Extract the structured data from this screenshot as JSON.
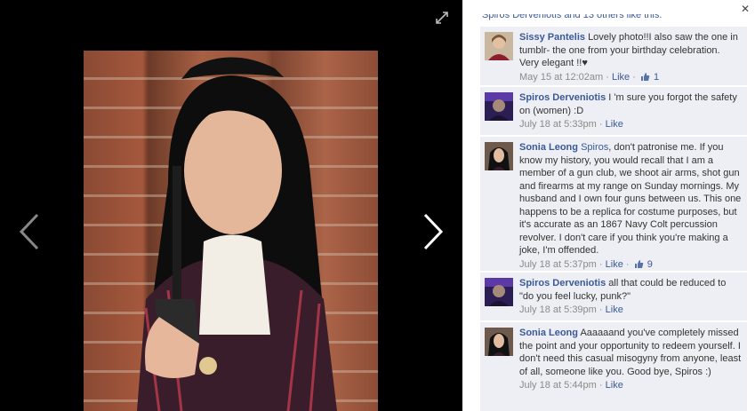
{
  "comments_header": {
    "truncated_text": "Spiros Derveniotis and 13 others like this."
  },
  "comments": [
    {
      "author": "Sissy Pantelis",
      "text": "Lovely photo!!I also saw the one in tumblr- the one from your birthday celebration. Very elegant !!♥",
      "timestamp": "May 15 at 12:02am",
      "sep1": "·",
      "like_label": "Like",
      "sep2": "·",
      "like_count": "1"
    },
    {
      "author": "Spiros Derveniotis",
      "text": "I 'm sure you forgot the safety on (women) :D",
      "timestamp": "July 18 at 5:33pm",
      "sep1": "·",
      "like_label": "Like"
    },
    {
      "author": "Sonia Leong",
      "mention": "Spiros",
      "text": ", don't patronise me. If you know my history, you would recall that I am a member of a gun club, we shoot air arms, shot gun and firearms at my range on Sunday mornings. My husband and I own four guns between us. This one happens to be a replica for costume purposes, but it's accurate as an 1867 Navy Colt percussion revolver. I don't care if you think you're making a joke, I'm offended.",
      "timestamp": "July 18 at 5:37pm",
      "sep1": "·",
      "like_label": "Like",
      "sep2": "·",
      "like_count": "9"
    },
    {
      "author": "Spiros Derveniotis",
      "text": "all that could be reduced to \"do you feel lucky, punk?\"",
      "timestamp": "July 18 at 5:39pm",
      "sep1": "·",
      "like_label": "Like"
    },
    {
      "author": "Sonia Leong",
      "text": "Aaaaaand you've completely missed the point and your opportunity to redeem yourself. I don't need this casual misogyny from anyone, least of all, someone like you. Good bye, Spiros :)",
      "timestamp": "July 18 at 5:44pm",
      "sep1": "·",
      "like_label": "Like"
    }
  ],
  "colors": {
    "link": "#3b5998",
    "comment_bg": "#edeff4",
    "meta": "#8a8a8a",
    "stage": "#000000"
  },
  "icons": [
    "expand-icon",
    "chevron-left-icon",
    "chevron-right-icon",
    "close-icon",
    "thumbs-up-icon"
  ]
}
